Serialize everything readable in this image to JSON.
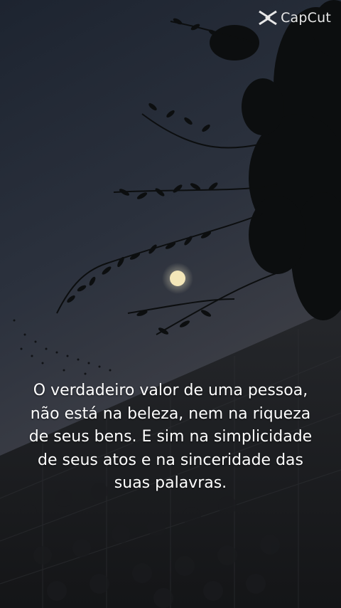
{
  "watermark": {
    "text": "CapCut",
    "icon": "capcut-logo-icon"
  },
  "caption": {
    "lines": [
      "O verdadeiro valor de uma pessoa,",
      "não está na beleza, nem na riqueza",
      "de seus bens. E sim na simplicidade",
      "de seus atos e na sinceridade das",
      "suas palavras."
    ]
  },
  "colors": {
    "sky_top": "#1f2530",
    "sky_mid": "#2c3240",
    "sky_horizon": "#3a3d46",
    "wall": "#202226",
    "foliage": "#0d0f10",
    "moon": "#f3e6b8",
    "text": "#ffffff"
  }
}
